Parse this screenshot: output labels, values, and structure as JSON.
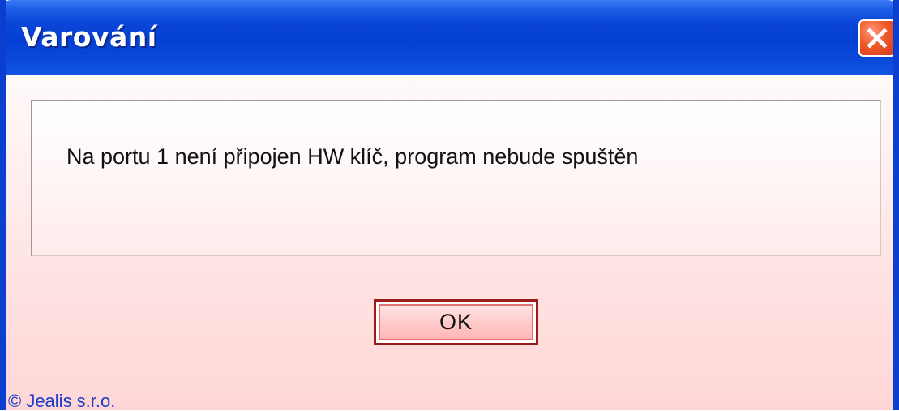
{
  "window": {
    "title": "Varování",
    "close_icon": "close-icon"
  },
  "message": {
    "text": "Na portu 1 není připojen HW klíč, program nebude spuštěn"
  },
  "buttons": {
    "ok_label": "OK"
  },
  "footer": {
    "copyright": "© Jealis s.r.o."
  },
  "colors": {
    "titlebar": "#0540d4",
    "close_button": "#e2471f",
    "dialog_background_bottom": "#ffd6d6",
    "ok_border": "#9b1b1b",
    "copyright_text": "#1a3cc8"
  }
}
